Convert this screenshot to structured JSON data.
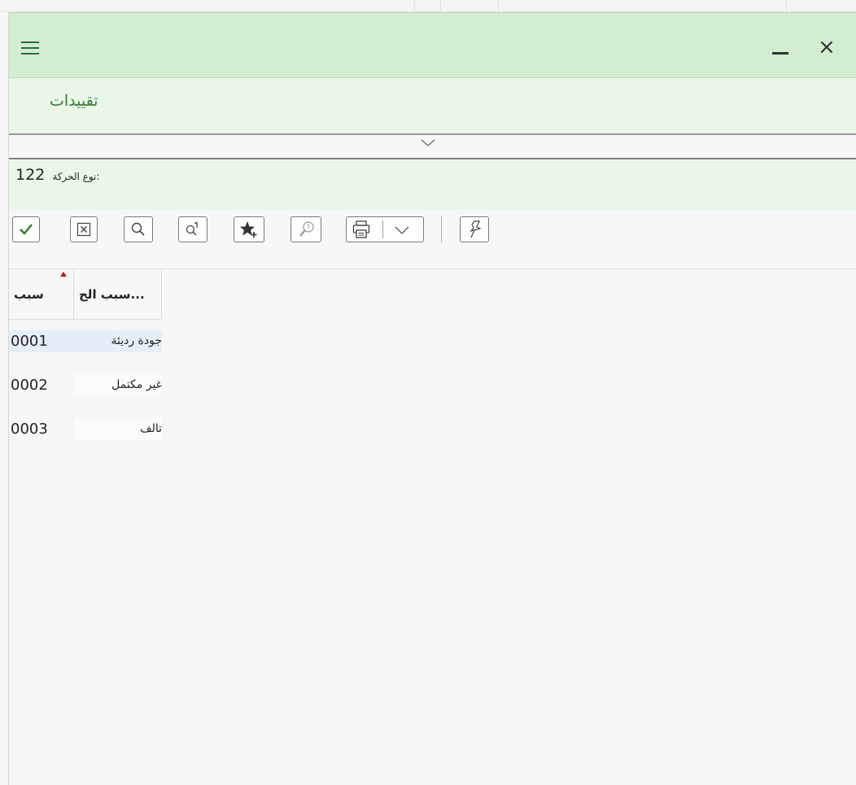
{
  "window": {
    "menu_icon": "menu-icon",
    "minimize_icon": "minimize-icon",
    "close_icon": "close-icon",
    "close_glyph": "×"
  },
  "header": {
    "tab_label": "تقييدات",
    "collapse_icon": "chevron-down-icon"
  },
  "info": {
    "label": "نوع الحركة:",
    "value": "122"
  },
  "toolbar": {
    "buttons": [
      {
        "name": "confirm-button",
        "icon": "checkmark-icon"
      },
      {
        "name": "cancel-button",
        "icon": "close-box-icon"
      },
      {
        "name": "search-button",
        "icon": "search-icon"
      },
      {
        "name": "search-plus-button",
        "icon": "search-next-icon"
      },
      {
        "name": "favorites-add-button",
        "icon": "star-add-icon"
      },
      {
        "name": "help-button",
        "icon": "help-icon"
      },
      {
        "name": "print-button",
        "icon": "printer-icon"
      },
      {
        "name": "pin-button",
        "icon": "pin-icon"
      }
    ],
    "print_dropdown_icon": "chevron-down-icon"
  },
  "table": {
    "columns": [
      {
        "label": "سبب",
        "sorted": "ascending"
      },
      {
        "label": "...سبب الح"
      }
    ],
    "rows": [
      {
        "code": "0001",
        "desc": "جودة رديئة",
        "selected": true
      },
      {
        "code": "0002",
        "desc": "غير مكتمل",
        "selected": false
      },
      {
        "code": "0003",
        "desc": "تالف",
        "selected": false
      }
    ]
  },
  "colors": {
    "titlebar": "#d3edd1",
    "header_bg": "#eaf6e8",
    "accent_green": "#3a7d3a",
    "selected_cell": "#e5eef8",
    "sort_indicator": "#c0121d"
  }
}
